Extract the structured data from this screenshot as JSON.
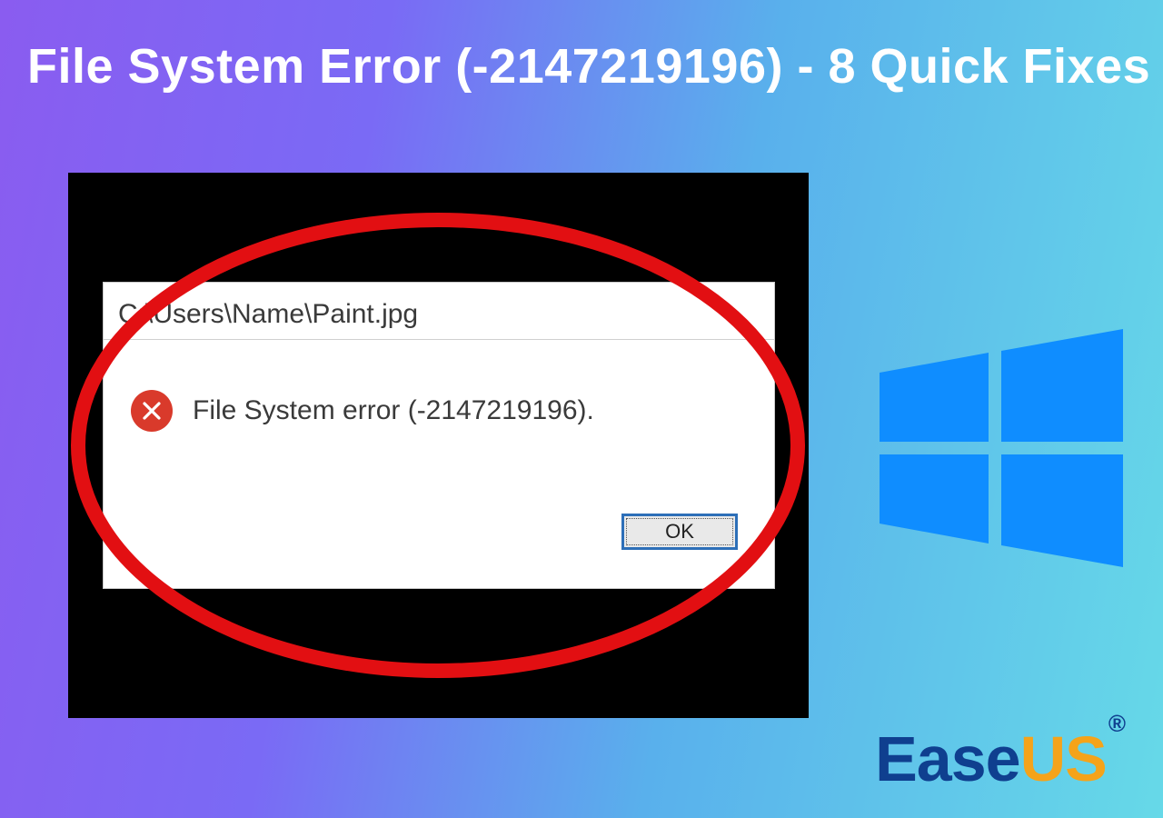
{
  "headline": "File System Error (-2147219196) - 8 Quick Fixes",
  "dialog": {
    "title_path": "C:\\Users\\Name\\Paint.jpg",
    "error_message": "File System error (-2147219196).",
    "ok_label": "OK"
  },
  "brand": {
    "part1": "Ease",
    "part2": "US",
    "reg": "®"
  },
  "colors": {
    "ellipse_stroke": "#e20f12",
    "error_icon_bg": "#d93a2b",
    "windows_blue": "#0f8dff",
    "brand_blue": "#0f3f8f",
    "brand_orange": "#f5a31a"
  }
}
